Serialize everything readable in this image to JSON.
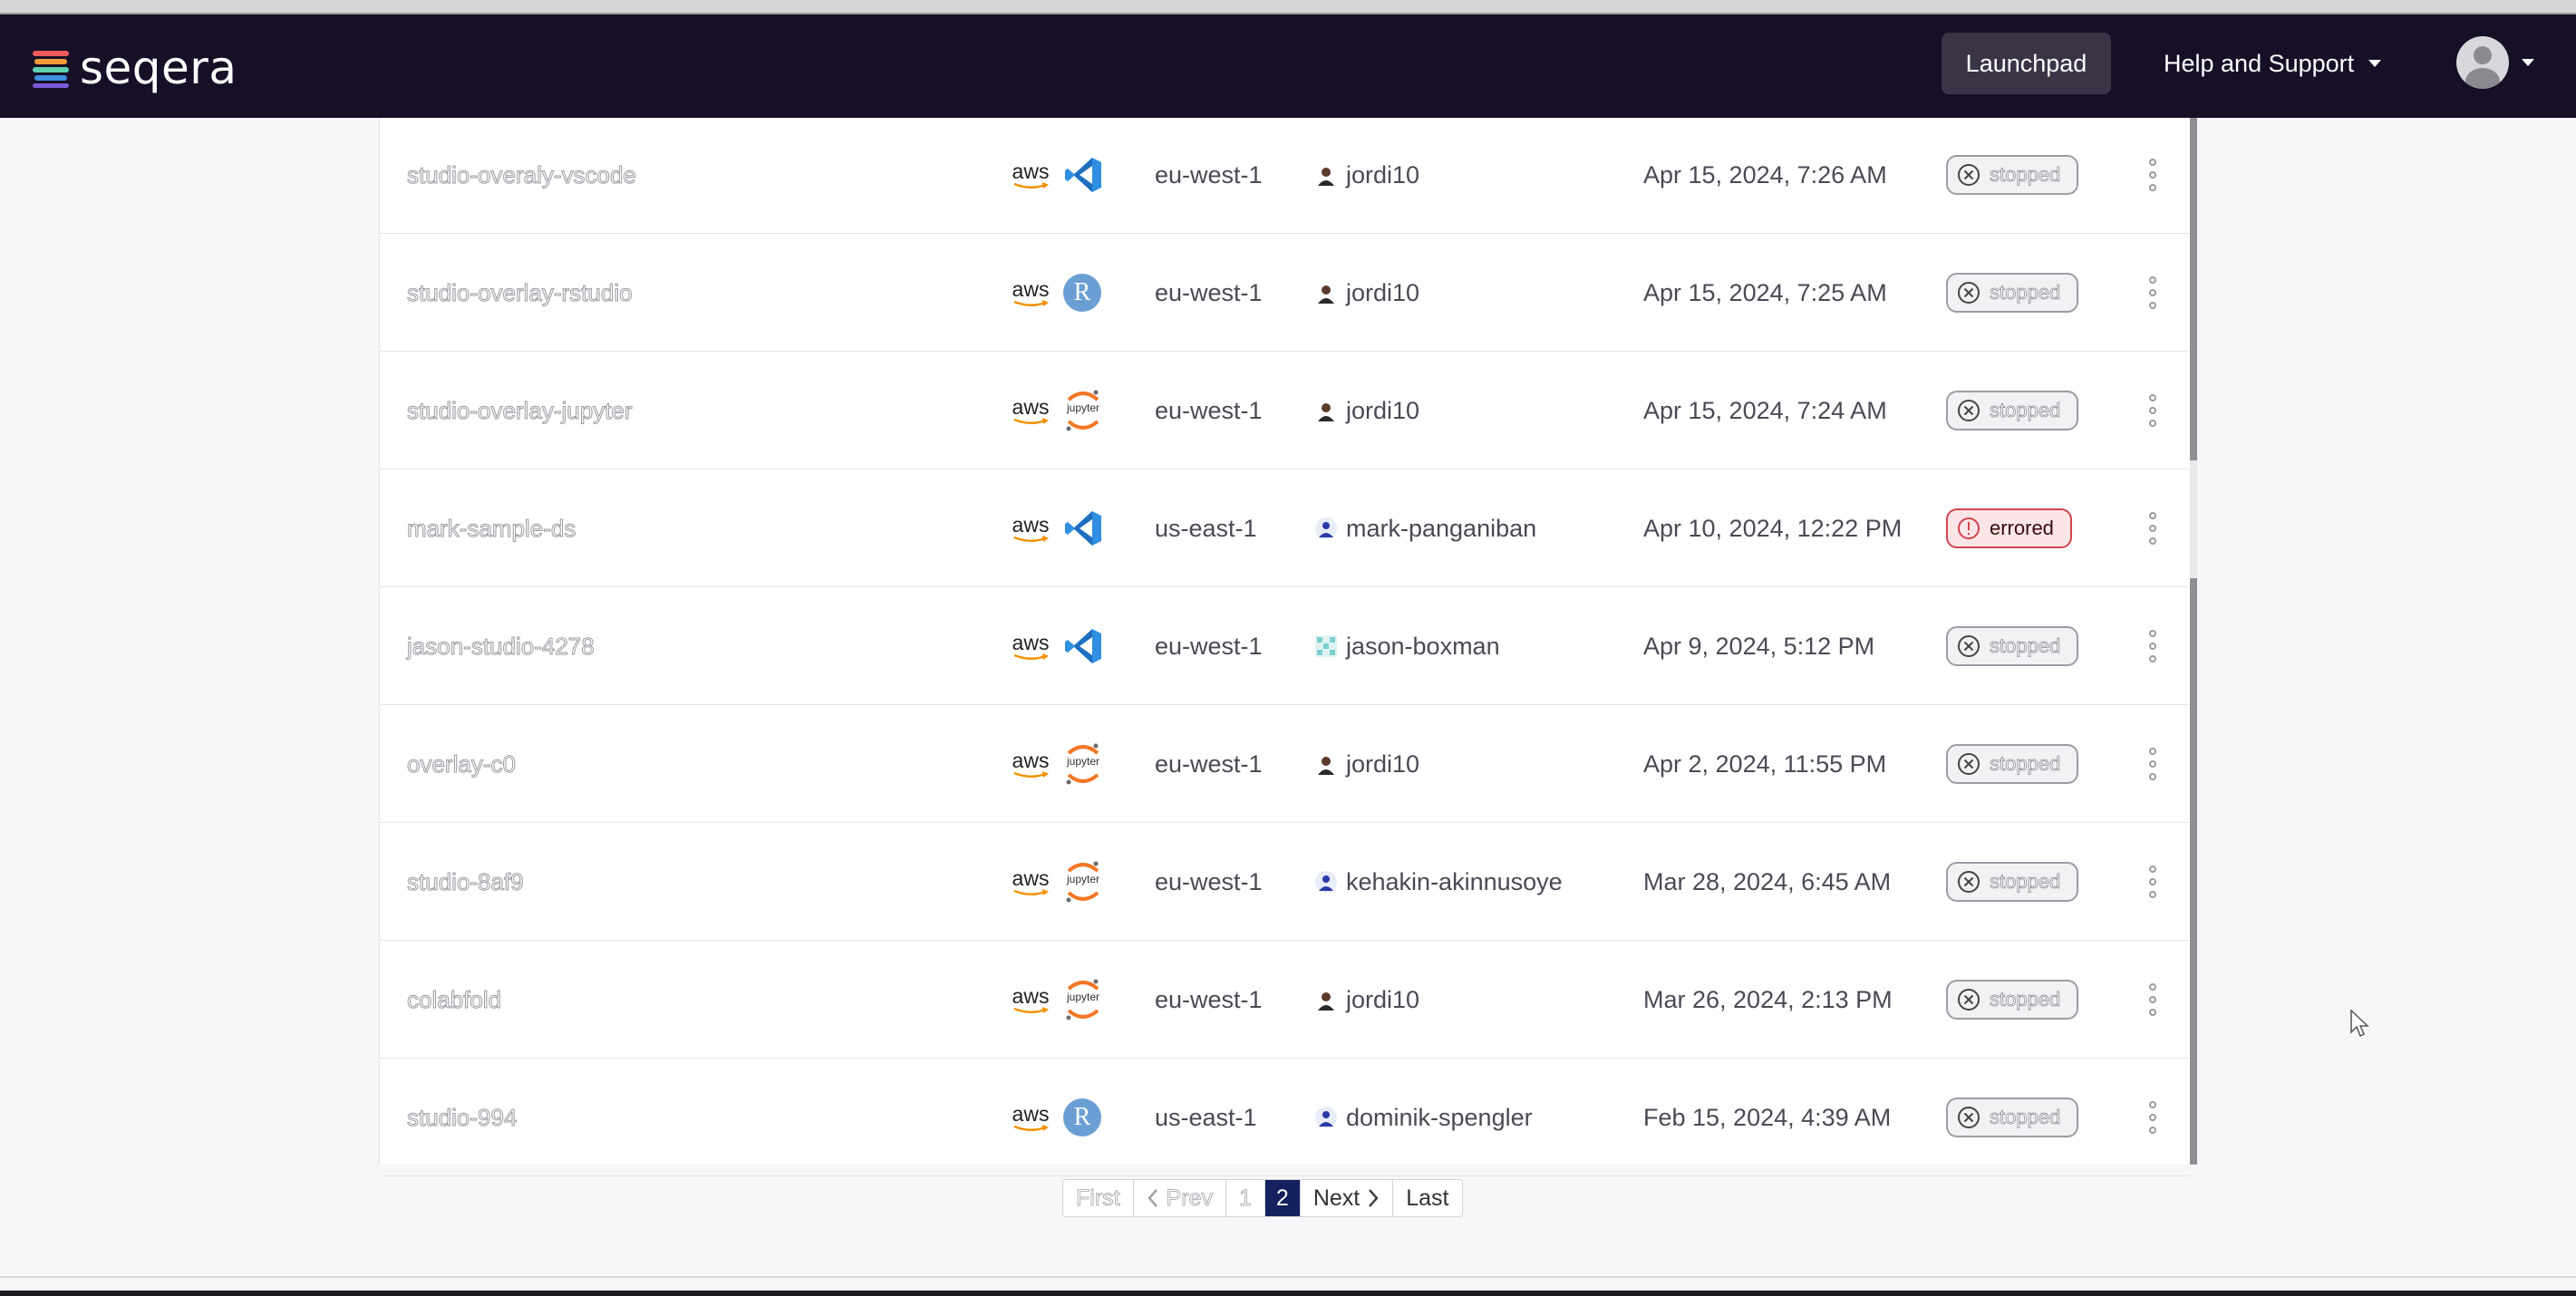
{
  "app": {
    "brand": "seqera"
  },
  "header": {
    "launchpad_label": "Launchpad",
    "help_label": "Help and Support"
  },
  "studios": [
    {
      "name": "studio-overaly-vscode",
      "provider": "aws",
      "tool": "vscode",
      "region": "eu-west-1",
      "user": "jordi10",
      "user_avatar": "photo",
      "date": "Apr 15, 2024, 7:26 AM",
      "status": "stopped"
    },
    {
      "name": "studio-overlay-rstudio",
      "provider": "aws",
      "tool": "rstudio",
      "region": "eu-west-1",
      "user": "jordi10",
      "user_avatar": "photo",
      "date": "Apr 15, 2024, 7:25 AM",
      "status": "stopped"
    },
    {
      "name": "studio-overlay-jupyter",
      "provider": "aws",
      "tool": "jupyter",
      "region": "eu-west-1",
      "user": "jordi10",
      "user_avatar": "photo",
      "date": "Apr 15, 2024, 7:24 AM",
      "status": "stopped"
    },
    {
      "name": "mark-sample-ds",
      "provider": "aws",
      "tool": "vscode",
      "region": "us-east-1",
      "user": "mark-panganiban",
      "user_avatar": "person",
      "date": "Apr 10, 2024, 12:22 PM",
      "status": "errored"
    },
    {
      "name": "jason-studio-4278",
      "provider": "aws",
      "tool": "vscode",
      "region": "eu-west-1",
      "user": "jason-boxman",
      "user_avatar": "pattern",
      "date": "Apr 9, 2024, 5:12 PM",
      "status": "stopped"
    },
    {
      "name": "overlay-c0",
      "provider": "aws",
      "tool": "jupyter",
      "region": "eu-west-1",
      "user": "jordi10",
      "user_avatar": "photo",
      "date": "Apr 2, 2024, 11:55 PM",
      "status": "stopped"
    },
    {
      "name": "studio-8af9",
      "provider": "aws",
      "tool": "jupyter",
      "region": "eu-west-1",
      "user": "kehakin-akinnusoye",
      "user_avatar": "person",
      "date": "Mar 28, 2024, 6:45 AM",
      "status": "stopped"
    },
    {
      "name": "colabfold",
      "provider": "aws",
      "tool": "jupyter",
      "region": "eu-west-1",
      "user": "jordi10",
      "user_avatar": "photo",
      "date": "Mar 26, 2024, 2:13 PM",
      "status": "stopped"
    },
    {
      "name": "studio-994",
      "provider": "aws",
      "tool": "rstudio",
      "region": "us-east-1",
      "user": "dominik-spengler",
      "user_avatar": "person",
      "date": "Feb 15, 2024, 4:39 AM",
      "status": "stopped"
    }
  ],
  "labels": {
    "aws": "aws",
    "rstudio": "R",
    "jupyter": "jupyter"
  },
  "pagination": {
    "first": "First",
    "prev": "Prev",
    "page1": "1",
    "page2": "2",
    "next": "Next",
    "last": "Last",
    "current_page": 2
  },
  "colors": {
    "navbar": "#160f26",
    "active_page": "#15205e",
    "error": "#d3434d",
    "aws_smile": "#f29100",
    "vscode_blue": "#2f8fe0",
    "jupyter_orange": "#f37626",
    "rstudio_blue": "#6b9fd4"
  }
}
